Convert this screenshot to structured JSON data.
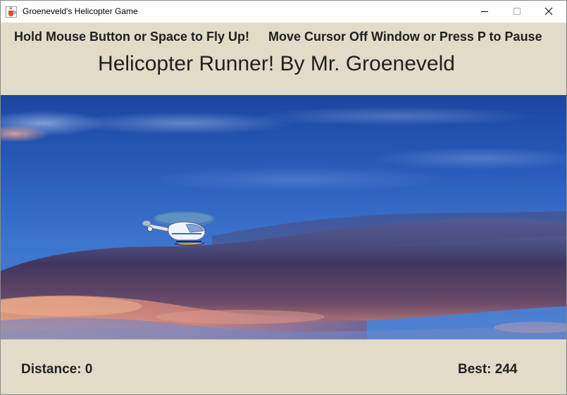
{
  "window": {
    "title": "Groeneveld's Helicopter Game",
    "icon": "java-cup-icon",
    "controls": [
      "minimize",
      "maximize",
      "close"
    ]
  },
  "header": {
    "instruction_left": "Hold Mouse Button or Space to Fly Up!",
    "instruction_right": "Move Cursor Off Window or Press P to Pause",
    "game_title": "Helicopter Runner! By Mr. Groeneveld"
  },
  "game": {
    "scene": "sky-background",
    "player": "helicopter-sprite"
  },
  "footer": {
    "distance_label": "Distance: 0",
    "best_label": "Best: 244"
  },
  "colors": {
    "panel_background": "#e2dbc8",
    "text": "#1f1f1f",
    "sky_top": "#1d4aa4",
    "sky_mid": "#3f78cf",
    "cloud_dark": "#3b3258",
    "cloud_glow": "#e89a78"
  }
}
